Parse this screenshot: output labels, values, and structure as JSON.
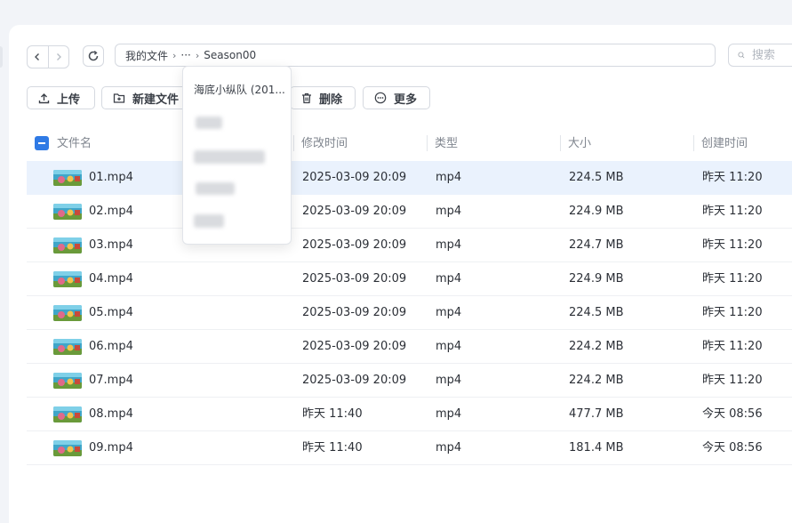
{
  "navigation": {
    "back_icon": "chevron-left-icon",
    "forward_icon": "chevron-right-icon",
    "refresh_icon": "refresh-icon"
  },
  "breadcrumb": {
    "root": "我的文件",
    "ellipsis": "···",
    "current": "Season00"
  },
  "search": {
    "placeholder": "搜索"
  },
  "toolbar": {
    "upload": "上传",
    "new_folder": "新建文件",
    "delete": "删除",
    "more": "更多"
  },
  "dropdown": {
    "items": [
      "海底小纵队 (201..."
    ]
  },
  "table": {
    "headers": {
      "name": "文件名",
      "modified": "修改时间",
      "type": "类型",
      "size": "大小",
      "created": "创建时间"
    },
    "rows": [
      {
        "name": "01.mp4",
        "modified": "2025-03-09 20:09",
        "type": "mp4",
        "size": "224.5 MB",
        "created": "昨天 11:20"
      },
      {
        "name": "02.mp4",
        "modified": "2025-03-09 20:09",
        "type": "mp4",
        "size": "224.9 MB",
        "created": "昨天 11:20"
      },
      {
        "name": "03.mp4",
        "modified": "2025-03-09 20:09",
        "type": "mp4",
        "size": "224.7 MB",
        "created": "昨天 11:20"
      },
      {
        "name": "04.mp4",
        "modified": "2025-03-09 20:09",
        "type": "mp4",
        "size": "224.9 MB",
        "created": "昨天 11:20"
      },
      {
        "name": "05.mp4",
        "modified": "2025-03-09 20:09",
        "type": "mp4",
        "size": "224.5 MB",
        "created": "昨天 11:20"
      },
      {
        "name": "06.mp4",
        "modified": "2025-03-09 20:09",
        "type": "mp4",
        "size": "224.2 MB",
        "created": "昨天 11:20"
      },
      {
        "name": "07.mp4",
        "modified": "2025-03-09 20:09",
        "type": "mp4",
        "size": "224.2 MB",
        "created": "昨天 11:20"
      },
      {
        "name": "08.mp4",
        "modified": "昨天 11:40",
        "type": "mp4",
        "size": "477.7 MB",
        "created": "今天 08:56"
      },
      {
        "name": "09.mp4",
        "modified": "昨天 11:40",
        "type": "mp4",
        "size": "181.4 MB",
        "created": "今天 08:56"
      }
    ]
  },
  "colors": {
    "accent": "#2f7ae5",
    "selected_row": "#eaf2fd",
    "header_text": "#80868f"
  }
}
